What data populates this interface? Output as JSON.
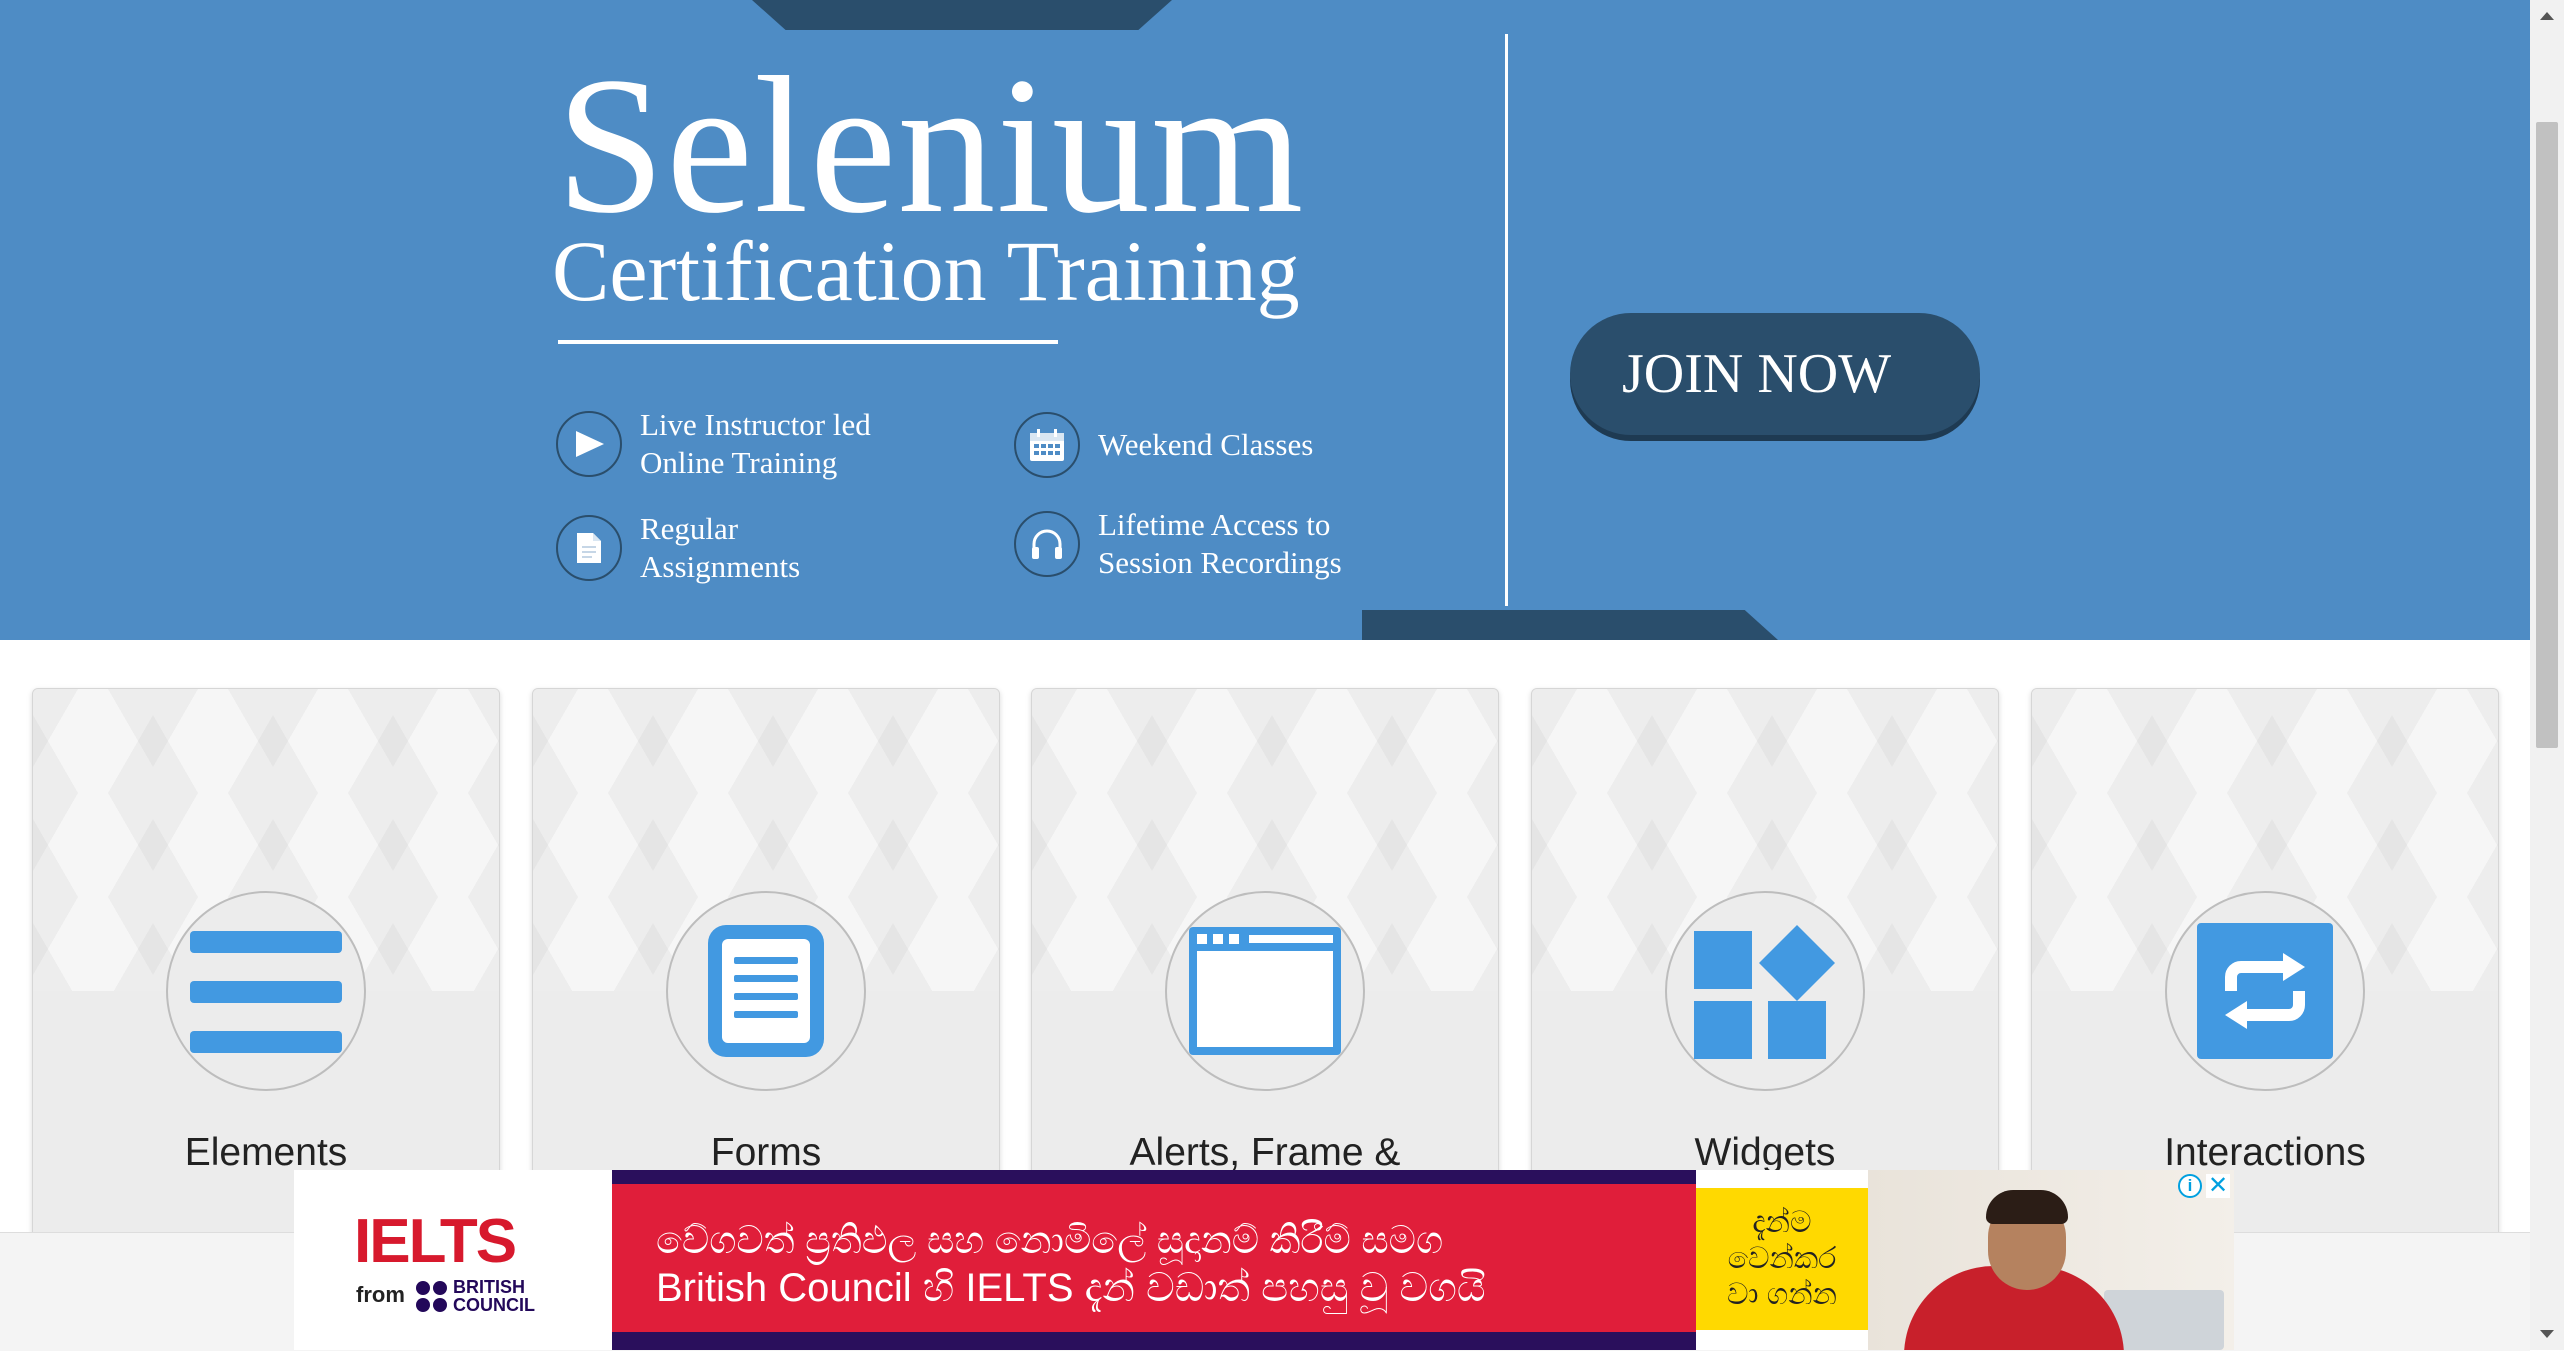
{
  "banner": {
    "title": "Selenium",
    "subtitle": "Certification Training",
    "features": [
      {
        "icon": "play-icon",
        "line1": "Live Instructor led",
        "line2": "Online Training"
      },
      {
        "icon": "calendar-icon",
        "line1": "Weekend Classes",
        "line2": ""
      },
      {
        "icon": "document-icon",
        "line1": "Regular",
        "line2": "Assignments"
      },
      {
        "icon": "headphones-icon",
        "line1": "Lifetime Access to",
        "line2": "Session Recordings"
      }
    ],
    "cta_label": "JOIN NOW"
  },
  "cards": [
    {
      "title": "Elements",
      "icon": "hamburger-list-icon"
    },
    {
      "title": "Forms",
      "icon": "form-document-icon"
    },
    {
      "title": "Alerts, Frame &",
      "icon": "browser-window-icon"
    },
    {
      "title": "Widgets",
      "icon": "widgets-grid-icon"
    },
    {
      "title": "Interactions",
      "icon": "repeat-arrows-icon"
    }
  ],
  "ad": {
    "brand": "IELTS",
    "from_label": "from",
    "partner_line1": "BRITISH",
    "partner_line2": "COUNCIL",
    "headline_line1": "වේගවත් ප්‍රතිඵල සහ නොමිලේ සූදානම් කිරීම් සමග",
    "headline_line2": "British Council හි IELTS දැන් වඩාත් පහසු වූ වගයි",
    "cta_line1": "දැන්ම",
    "cta_line2": "වෙන්කර",
    "cta_line3": "වා ගන්න",
    "info_symbol": "i",
    "close_symbol": "✕"
  },
  "colors": {
    "banner_bg": "#4e8cc5",
    "banner_dark": "#2a4e6c",
    "icon_blue": "#4299e1",
    "ad_red": "#e01e3a",
    "ad_yellow": "#ffd900"
  }
}
